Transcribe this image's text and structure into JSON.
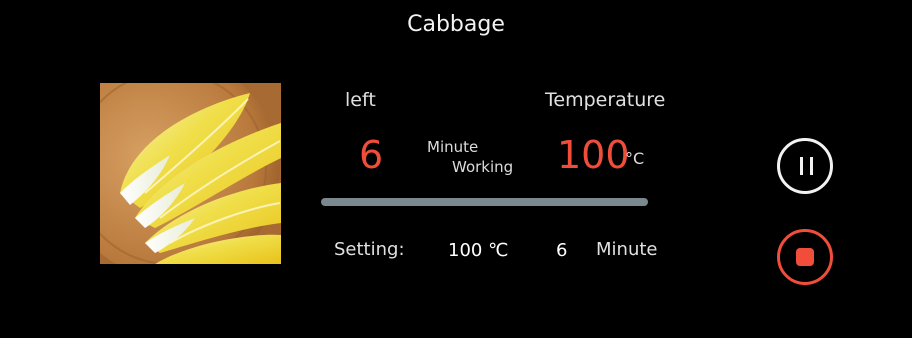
{
  "header": {
    "title": "Cabbage"
  },
  "status": {
    "left_label": "left",
    "remaining_minutes": "6",
    "minute_label": "Minute",
    "working_label": "Working",
    "temperature_label": "Temperature",
    "current_temperature": "100",
    "temperature_unit": "°C",
    "progress_fraction": 1.0
  },
  "setting": {
    "label": "Setting:",
    "temperature": "100 ℃",
    "minutes": "6",
    "minute_unit": "Minute"
  },
  "controls": {
    "pause_icon": "pause-icon",
    "stop_icon": "stop-icon"
  },
  "colors": {
    "accent": "#f04e3b",
    "background": "#000000",
    "text": "#e0e0e0",
    "progress_track": "#5f6b72"
  }
}
